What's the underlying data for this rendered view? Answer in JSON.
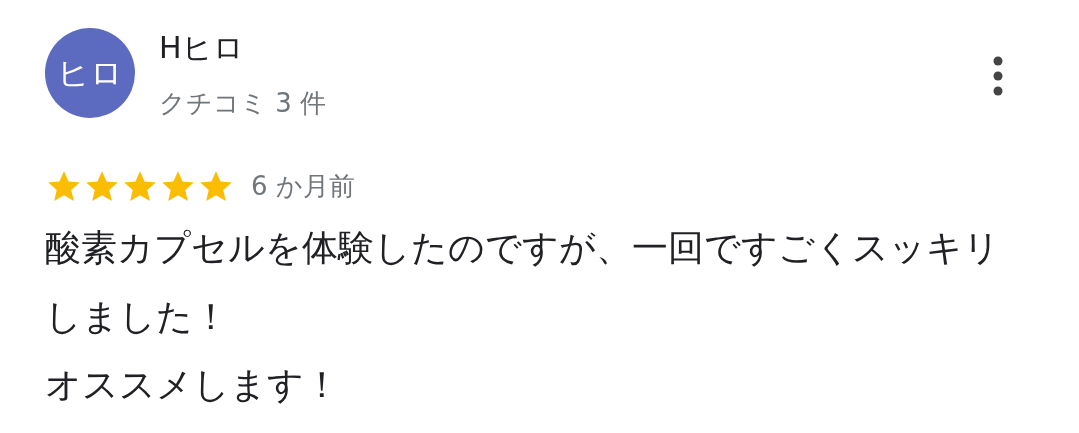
{
  "review": {
    "avatar": {
      "initials": "ヒロ",
      "color": "#5c6bc0"
    },
    "author": "Hヒロ",
    "review_count": "クチコミ 3 件",
    "stars": 5,
    "time": "6 か月前",
    "paragraphs": [
      "酸素カプセルを体験したのですが、一回ですごくスッキリしました！",
      "オススメします！"
    ]
  }
}
